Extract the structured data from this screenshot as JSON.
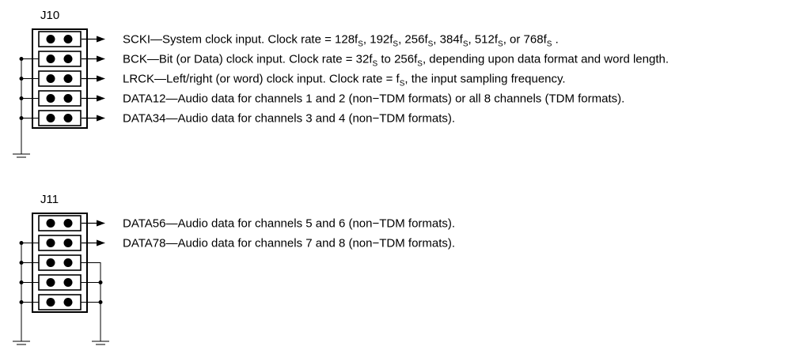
{
  "headers": {
    "j10": "J10",
    "j11": "J11"
  },
  "j10_signals": [
    {
      "name": "SCKI",
      "desc": [
        {
          "t": "System clock input. Clock rate = 128f"
        },
        {
          "t": "S",
          "sub": true
        },
        {
          "t": ", 192f"
        },
        {
          "t": "S",
          "sub": true
        },
        {
          "t": ", 256f"
        },
        {
          "t": "S",
          "sub": true
        },
        {
          "t": ", 384f"
        },
        {
          "t": "S",
          "sub": true
        },
        {
          "t": ", 512f"
        },
        {
          "t": "S",
          "sub": true
        },
        {
          "t": ", or 768f"
        },
        {
          "t": "S",
          "sub": true
        },
        {
          "t": " ."
        }
      ]
    },
    {
      "name": "BCK",
      "desc": [
        {
          "t": "Bit (or Data) clock input. Clock rate = 32f"
        },
        {
          "t": "S",
          "sub": true
        },
        {
          "t": " to 256f"
        },
        {
          "t": "S",
          "sub": true
        },
        {
          "t": ", depending upon data format and word length."
        }
      ]
    },
    {
      "name": "LRCK",
      "desc": [
        {
          "t": "Left/right (or word) clock input. Clock rate = f"
        },
        {
          "t": "S",
          "sub": true
        },
        {
          "t": ", the input sampling frequency."
        }
      ]
    },
    {
      "name": "DATA12",
      "desc": [
        {
          "t": "Audio data for channels 1 and 2 (non−TDM formats) or all 8 channels (TDM formats)."
        }
      ]
    },
    {
      "name": "DATA34",
      "desc": [
        {
          "t": "Audio data for channels 3 and 4 (non−TDM formats)."
        }
      ]
    }
  ],
  "j11_signals": [
    {
      "name": "DATA56",
      "desc": [
        {
          "t": "Audio data for channels 5 and 6 (non−TDM formats)."
        }
      ]
    },
    {
      "name": "DATA78",
      "desc": [
        {
          "t": "Audio data for channels 7 and 8 (non−TDM formats)."
        }
      ]
    }
  ]
}
